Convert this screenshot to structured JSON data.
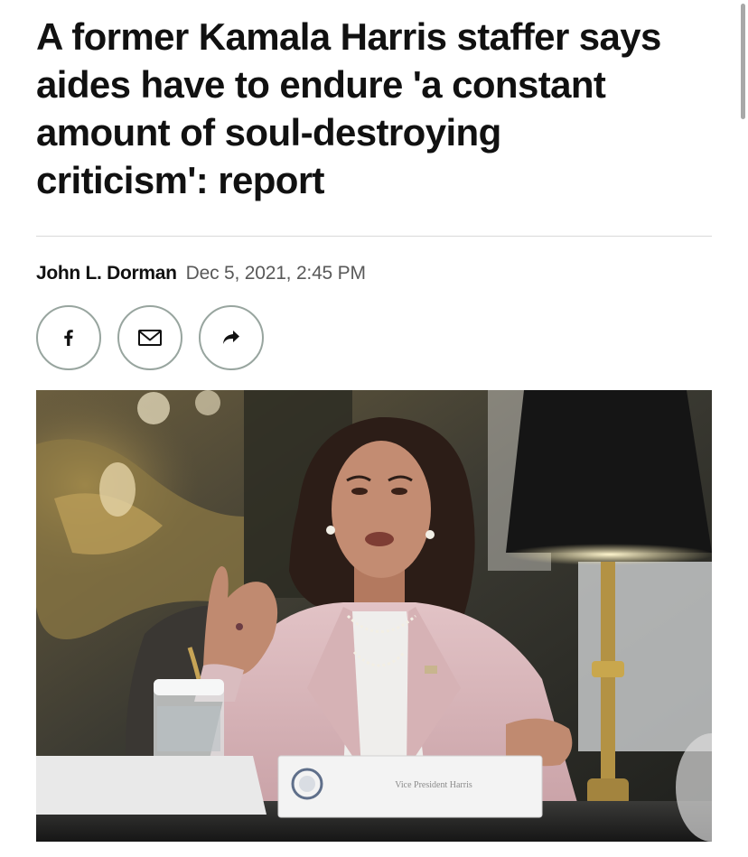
{
  "article": {
    "headline": "A former Kamala Harris staffer says aides have to endure 'a constant amount of soul-destroying criticism': report",
    "author": "John L. Dorman",
    "date": "Dec 5, 2021, 2:45 PM"
  },
  "share": {
    "buttons": [
      {
        "icon": "facebook-icon"
      },
      {
        "icon": "email-icon"
      },
      {
        "icon": "share-arrow-icon"
      }
    ]
  },
  "photo": {
    "placard_text": "Vice President Harris"
  },
  "colors": {
    "text": "#111111",
    "date_gray": "#595959",
    "divider": "#d9d9d9",
    "share_border": "#98a59f"
  }
}
